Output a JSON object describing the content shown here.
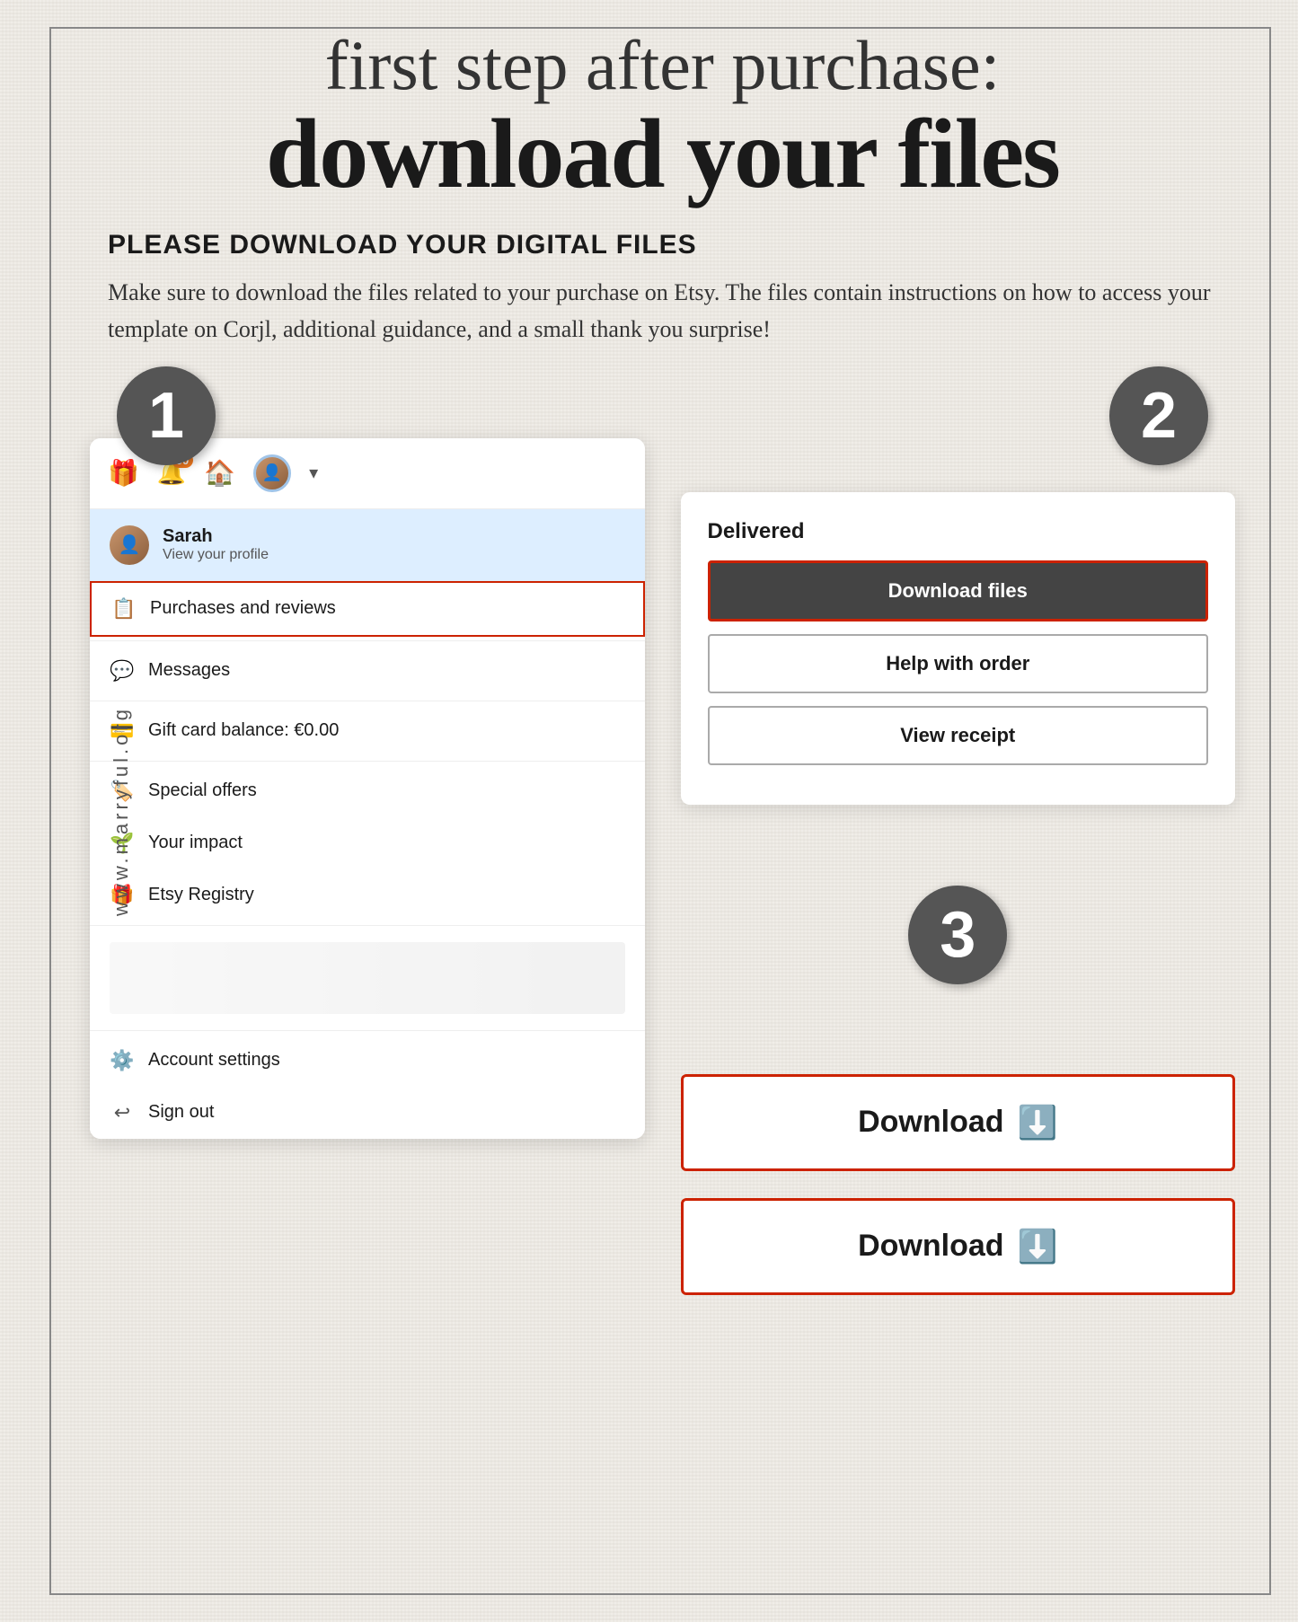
{
  "page": {
    "background_color": "#f0ede8",
    "border_color": "#888",
    "vertical_text": "www.marryful.org"
  },
  "header": {
    "handwritten_line": "first step after purchase:",
    "big_title": "download your files"
  },
  "intro": {
    "heading": "PLEASE DOWNLOAD YOUR DIGITAL FILES",
    "body": "Make sure to download the files related to your purchase on Etsy. The files contain instructions on how to access your template on Corjl, additional guidance, and a small thank you surprise!"
  },
  "steps": {
    "step1": {
      "number": "1",
      "etsy_topbar": {
        "notification_count": "50"
      },
      "profile": {
        "name": "Sarah",
        "sub_label": "View your profile"
      },
      "menu_items": [
        {
          "icon": "📋",
          "label": "Purchases and reviews",
          "highlighted": true
        },
        {
          "icon": "💬",
          "label": "Messages",
          "highlighted": false
        },
        {
          "icon": "💳",
          "label": "Gift card balance: €0.00",
          "highlighted": false
        },
        {
          "icon": "🏷️",
          "label": "Special offers",
          "highlighted": false
        },
        {
          "icon": "🌱",
          "label": "Your impact",
          "highlighted": false
        },
        {
          "icon": "🎁",
          "label": "Etsy Registry",
          "highlighted": false
        },
        {
          "icon": "⚙️",
          "label": "Account settings",
          "highlighted": false
        },
        {
          "icon": "↩️",
          "label": "Sign out",
          "highlighted": false
        }
      ]
    },
    "step2": {
      "number": "2",
      "delivered_label": "Delivered",
      "buttons": [
        {
          "label": "Download files",
          "style": "dark",
          "highlighted": true
        },
        {
          "label": "Help with order",
          "style": "outline",
          "highlighted": false
        },
        {
          "label": "View receipt",
          "style": "outline",
          "highlighted": false
        }
      ]
    },
    "step3": {
      "number": "3",
      "buttons": [
        {
          "label": "Download",
          "icon": "⬇️"
        },
        {
          "label": "Download",
          "icon": "⬇️"
        }
      ]
    }
  }
}
